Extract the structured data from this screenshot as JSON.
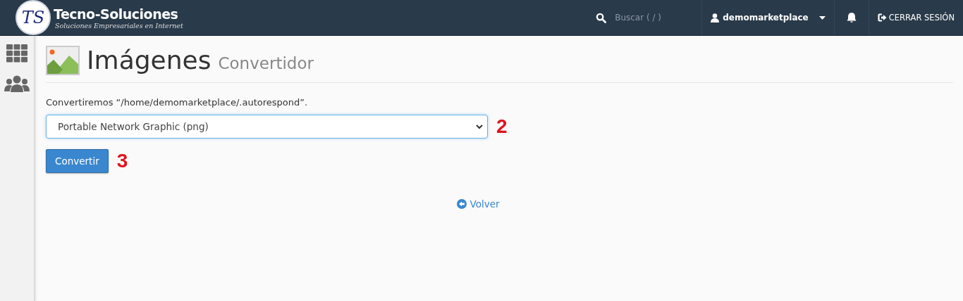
{
  "header": {
    "logo_initials": "TS",
    "brand": "Tecno-Soluciones",
    "tagline": "Soluciones Empresariales en Internet",
    "search": {
      "placeholder": "Buscar ( / )"
    },
    "user": "demomarketplace",
    "logout": "CERRAR SESIÓN"
  },
  "sidebar": {
    "items": [
      {
        "kind": "apps",
        "selected": false
      },
      {
        "kind": "users",
        "selected": false
      }
    ]
  },
  "page": {
    "title": "Imágenes",
    "subtitle": "Convertidor",
    "message": "Convertiremos “/home/demomarketplace/.autorespond”.",
    "format": {
      "value": "Portable Network Graphic (png)"
    },
    "convert_button": "Convertir",
    "back_link": "Volver"
  },
  "annotations": [
    "2",
    "3"
  ]
}
